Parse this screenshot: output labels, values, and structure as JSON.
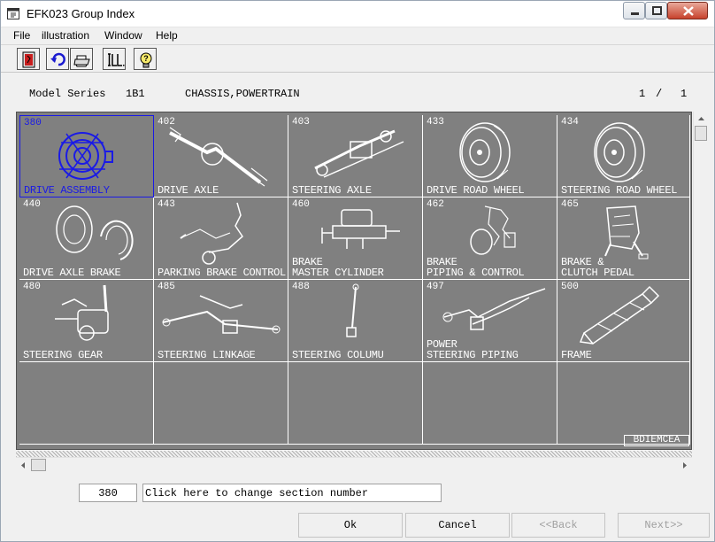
{
  "window": {
    "title": "EFK023 Group Index"
  },
  "menu": [
    {
      "label": "File"
    },
    {
      "label": "illustration"
    },
    {
      "label": "Window"
    },
    {
      "label": "Help"
    }
  ],
  "toolbar": [
    {
      "icon": "exit-door-icon"
    },
    {
      "icon": "undo-arrow-icon"
    },
    {
      "icon": "printer-icon"
    },
    {
      "icon": "illustration-icon",
      "label": "ILL."
    },
    {
      "icon": "help-bulb-icon"
    }
  ],
  "header": {
    "model_series_label": "Model Series",
    "model_series_value": "1B1",
    "section_title": "CHASSIS,POWERTRAIN",
    "page_current": "1",
    "page_separator": "/",
    "page_total": "1"
  },
  "groups": [
    {
      "number": "380",
      "label": "DRIVE ASSEMBLY",
      "selected": true
    },
    {
      "number": "402",
      "label": "DRIVE AXLE"
    },
    {
      "number": "403",
      "label": "STEERING AXLE"
    },
    {
      "number": "433",
      "label": "DRIVE ROAD WHEEL"
    },
    {
      "number": "434",
      "label": "STEERING ROAD WHEEL"
    },
    {
      "number": "440",
      "label": "DRIVE AXLE BRAKE"
    },
    {
      "number": "443",
      "label": "PARKING BRAKE CONTROL"
    },
    {
      "number": "460",
      "label": "BRAKE",
      "label2": "MASTER CYLINDER"
    },
    {
      "number": "462",
      "label": "BRAKE",
      "label2": "PIPING & CONTROL"
    },
    {
      "number": "465",
      "label": "BRAKE &",
      "label2": "CLUTCH PEDAL"
    },
    {
      "number": "480",
      "label": "STEERING GEAR"
    },
    {
      "number": "485",
      "label": "STEERING LINKAGE"
    },
    {
      "number": "488",
      "label": "STEERING COLUMU"
    },
    {
      "number": "497",
      "label": "POWER",
      "label2": "STEERING PIPING"
    },
    {
      "number": "500",
      "label": "FRAME"
    }
  ],
  "watermark": "BDIEMCEA",
  "footer": {
    "section_number": "380",
    "hint": "Click here to change section number"
  },
  "buttons": {
    "ok": "Ok",
    "cancel": "Cancel",
    "back": "<<Back",
    "next": "Next>>"
  }
}
